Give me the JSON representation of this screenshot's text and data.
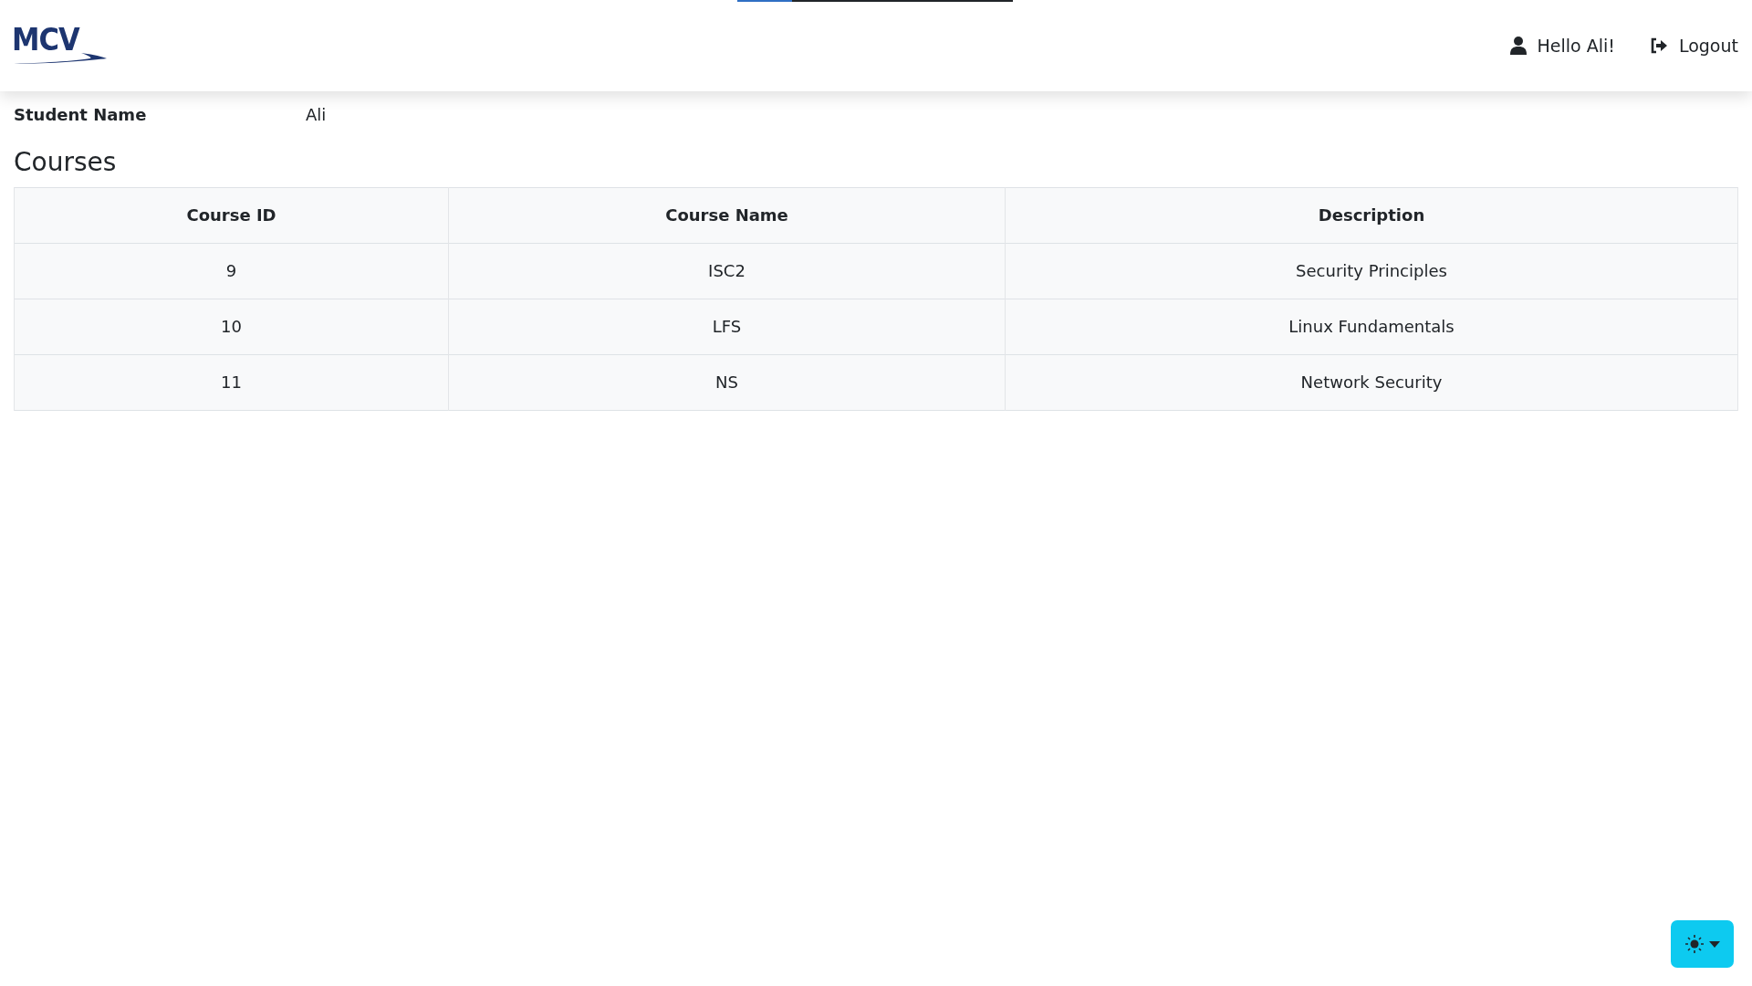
{
  "loading_bar": {
    "level": 0.2
  },
  "navbar": {
    "brand": "MCV",
    "user_greeting": "Hello Ali!",
    "logout": "Logout"
  },
  "student": {
    "label": "Student Name",
    "value": "Ali"
  },
  "courses": {
    "heading": "Courses",
    "columns": [
      "Course ID",
      "Course Name",
      "Description"
    ],
    "rows": [
      [
        "9",
        "ISC2",
        "Security Principles"
      ],
      [
        "10",
        "LFS",
        "Linux Fundamentals"
      ],
      [
        "11",
        "NS",
        "Network Security"
      ]
    ]
  },
  "theme_toggle": {
    "expanded": false
  }
}
